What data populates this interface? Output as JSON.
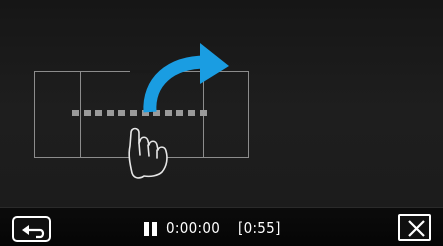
{
  "player": {
    "elapsed_time": "0:00:00",
    "total_time": "[0:55]",
    "state": "paused"
  },
  "gesture_hint": {
    "gesture": "swipe-up-right",
    "icon": "hand-pointer-icon",
    "arrow": "curved-arrow-icon",
    "arrow_color": "#1a9de2",
    "track_dot_count": 12
  },
  "toolbar": {
    "back_icon": "return-arrow-icon",
    "pause_icon": "pause-icon",
    "close_icon": "close-icon"
  },
  "colors": {
    "background": "#1c1c1c",
    "toolbar": "#070707",
    "accent": "#1a9de2",
    "text": "#ffffff"
  }
}
